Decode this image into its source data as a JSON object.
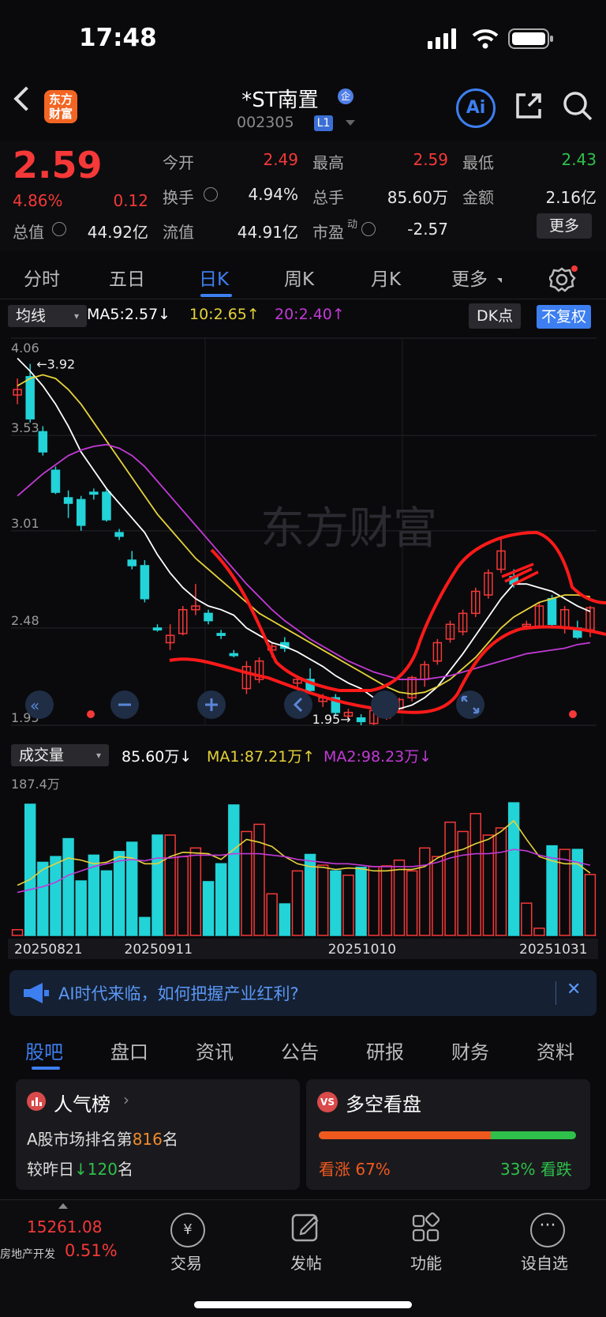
{
  "status": {
    "time": "17:48"
  },
  "header": {
    "logo_line1": "东方",
    "logo_line2": "财富",
    "stock_name": "*ST南置",
    "stock_code": "002305",
    "level": "L1",
    "ai_label": "Ai"
  },
  "quote": {
    "price": "2.59",
    "change_pct": "4.86%",
    "change": "0.12",
    "open_label": "今开",
    "open": "2.49",
    "high_label": "最高",
    "high": "2.59",
    "low_label": "最低",
    "low": "2.43",
    "turnover_label": "换手",
    "turnover": "4.94%",
    "volume_label": "总手",
    "volume": "85.60万",
    "amount_label": "金额",
    "amount": "2.16亿",
    "mktcap_label": "总值",
    "mktcap": "44.92亿",
    "float_label": "流值",
    "float": "44.91亿",
    "pe_label": "市盈",
    "pe_sup": "动",
    "pe": "-2.57",
    "more": "更多"
  },
  "ktabs": [
    "分时",
    "五日",
    "日K",
    "周K",
    "月K",
    "更多"
  ],
  "ma_bar": {
    "selector": "均线",
    "ma5": "MA5:2.57↓",
    "ma10": "10:2.65↑",
    "ma20": "20:2.40↑",
    "dk": "DK点",
    "adjust": "不复权"
  },
  "vol_bar": {
    "selector": "成交量",
    "vol": "85.60万↓",
    "ma1": "MA1:87.21万↑",
    "ma2": "MA2:98.23万↓"
  },
  "colors": {
    "up": "#f53838",
    "down": "#22d3d8",
    "ma5": "#ffffff",
    "ma10": "#e6d23a",
    "ma20": "#c23ad6",
    "accent": "#3d7ff0"
  },
  "chart_data": {
    "type": "candlestick",
    "y_ticks": [
      "4.06",
      "3.53",
      "3.01",
      "2.48",
      "1.95"
    ],
    "ylim": [
      1.95,
      4.06
    ],
    "high_annotation": "3.92",
    "low_annotation": "1.95",
    "ohlc": [
      [
        3.75,
        3.84,
        3.7,
        3.78
      ],
      [
        3.85,
        3.92,
        3.6,
        3.62
      ],
      [
        3.55,
        3.58,
        3.42,
        3.44
      ],
      [
        3.34,
        3.36,
        3.21,
        3.22
      ],
      [
        3.19,
        3.23,
        3.08,
        3.16
      ],
      [
        3.18,
        3.2,
        3.01,
        3.04
      ],
      [
        3.22,
        3.24,
        3.18,
        3.21
      ],
      [
        3.22,
        3.24,
        3.06,
        3.07
      ],
      [
        3.0,
        3.02,
        2.96,
        2.98
      ],
      [
        2.85,
        2.9,
        2.8,
        2.82
      ],
      [
        2.82,
        2.85,
        2.62,
        2.64
      ],
      [
        2.48,
        2.5,
        2.46,
        2.47
      ],
      [
        2.4,
        2.5,
        2.36,
        2.44
      ],
      [
        2.45,
        2.6,
        2.44,
        2.58
      ],
      [
        2.58,
        2.72,
        2.55,
        2.6
      ],
      [
        2.56,
        2.58,
        2.5,
        2.52
      ],
      [
        2.45,
        2.47,
        2.42,
        2.44
      ],
      [
        2.34,
        2.36,
        2.32,
        2.33
      ],
      [
        2.15,
        2.3,
        2.12,
        2.27
      ],
      [
        2.2,
        2.32,
        2.18,
        2.3
      ],
      [
        2.36,
        2.4,
        2.32,
        2.38
      ],
      [
        2.4,
        2.43,
        2.35,
        2.37
      ],
      [
        2.18,
        2.22,
        2.15,
        2.2
      ],
      [
        2.2,
        2.26,
        2.12,
        2.14
      ],
      [
        2.08,
        2.12,
        2.05,
        2.1
      ],
      [
        2.1,
        2.12,
        2.0,
        2.02
      ],
      [
        2.0,
        2.04,
        1.98,
        2.02
      ],
      [
        1.99,
        2.01,
        1.95,
        1.97
      ],
      [
        1.96,
        2.05,
        1.95,
        2.03
      ],
      [
        1.99,
        2.05,
        1.98,
        2.04
      ],
      [
        2.04,
        2.1,
        2.02,
        2.09
      ],
      [
        2.1,
        2.22,
        2.08,
        2.21
      ],
      [
        2.2,
        2.3,
        2.16,
        2.28
      ],
      [
        2.3,
        2.42,
        2.28,
        2.4
      ],
      [
        2.42,
        2.52,
        2.4,
        2.5
      ],
      [
        2.46,
        2.58,
        2.44,
        2.56
      ],
      [
        2.56,
        2.7,
        2.54,
        2.68
      ],
      [
        2.66,
        2.8,
        2.64,
        2.78
      ],
      [
        2.8,
        2.98,
        2.78,
        2.9
      ],
      [
        2.76,
        2.8,
        2.7,
        2.72
      ],
      [
        2.49,
        2.52,
        2.47,
        2.5
      ],
      [
        2.49,
        2.62,
        2.48,
        2.6
      ],
      [
        2.64,
        2.66,
        2.48,
        2.5
      ],
      [
        2.48,
        2.6,
        2.45,
        2.58
      ],
      [
        2.48,
        2.52,
        2.42,
        2.43
      ],
      [
        2.47,
        2.6,
        2.43,
        2.59
      ]
    ],
    "ma5": [
      3.95,
      3.88,
      3.8,
      3.7,
      3.58,
      3.44,
      3.34,
      3.24,
      3.16,
      3.08,
      3.0,
      2.88,
      2.78,
      2.7,
      2.64,
      2.6,
      2.58,
      2.55,
      2.48,
      2.44,
      2.4,
      2.38,
      2.35,
      2.31,
      2.27,
      2.22,
      2.18,
      2.15,
      2.1,
      2.06,
      2.04,
      2.06,
      2.1,
      2.16,
      2.25,
      2.34,
      2.44,
      2.54,
      2.64,
      2.72,
      2.72,
      2.7,
      2.68,
      2.64,
      2.6,
      2.57
    ],
    "ma10": [
      3.8,
      3.84,
      3.86,
      3.84,
      3.78,
      3.7,
      3.6,
      3.5,
      3.4,
      3.3,
      3.2,
      3.1,
      3.02,
      2.94,
      2.86,
      2.8,
      2.74,
      2.68,
      2.62,
      2.56,
      2.52,
      2.48,
      2.44,
      2.4,
      2.36,
      2.32,
      2.28,
      2.24,
      2.2,
      2.16,
      2.13,
      2.12,
      2.13,
      2.16,
      2.2,
      2.26,
      2.32,
      2.4,
      2.48,
      2.54,
      2.58,
      2.62,
      2.64,
      2.66,
      2.66,
      2.65
    ],
    "ma20": [
      3.2,
      3.26,
      3.32,
      3.37,
      3.42,
      3.45,
      3.47,
      3.48,
      3.46,
      3.42,
      3.36,
      3.28,
      3.2,
      3.12,
      3.04,
      2.96,
      2.88,
      2.8,
      2.72,
      2.65,
      2.58,
      2.52,
      2.47,
      2.42,
      2.38,
      2.34,
      2.3,
      2.27,
      2.24,
      2.22,
      2.2,
      2.2,
      2.2,
      2.21,
      2.22,
      2.24,
      2.26,
      2.28,
      2.3,
      2.32,
      2.34,
      2.35,
      2.36,
      2.37,
      2.39,
      2.4
    ],
    "volume_max_label": "187.4万",
    "volume": [
      8,
      183,
      102,
      110,
      135,
      76,
      112,
      90,
      117,
      130,
      25,
      140,
      140,
      110,
      122,
      75,
      100,
      182,
      145,
      155,
      58,
      44,
      90,
      113,
      98,
      90,
      84,
      95,
      96,
      97,
      105,
      90,
      122,
      110,
      158,
      145,
      170,
      140,
      150,
      185,
      45,
      10,
      125,
      120,
      120,
      85
    ],
    "vol_ma1": [
      70,
      78,
      92,
      100,
      108,
      105,
      100,
      102,
      110,
      108,
      100,
      100,
      110,
      116,
      115,
      114,
      106,
      120,
      134,
      130,
      124,
      110,
      100,
      96,
      95,
      92,
      94,
      93,
      90,
      90,
      92,
      92,
      96,
      108,
      116,
      120,
      128,
      134,
      145,
      160,
      134,
      110,
      104,
      100,
      100,
      87
    ],
    "vol_ma2": [
      60,
      64,
      68,
      74,
      84,
      90,
      96,
      100,
      104,
      106,
      104,
      108,
      108,
      110,
      112,
      112,
      112,
      114,
      114,
      114,
      112,
      110,
      106,
      104,
      102,
      100,
      100,
      98,
      96,
      96,
      96,
      96,
      98,
      102,
      108,
      112,
      114,
      114,
      116,
      120,
      118,
      112,
      108,
      106,
      102,
      98
    ],
    "x_dates": [
      "20250821",
      "20250911",
      "20251010",
      "20251031"
    ]
  },
  "ad": {
    "text": "AI时代来临，如何把握产业红利?",
    "close": "✕"
  },
  "btabs": [
    "股吧",
    "盘口",
    "资讯",
    "公告",
    "研报",
    "财务",
    "资料"
  ],
  "popularity": {
    "title": "人气榜",
    "rank_prefix": "A股市场排名第",
    "rank": "816",
    "rank_suffix": "名",
    "cmp_prefix": "较昨日",
    "cmp_val": "120",
    "cmp_suffix": "名"
  },
  "sentiment": {
    "title": "多空看盘",
    "badge": "VS",
    "bull_label": "看涨",
    "bull_pct": "67%",
    "bear_pct": "33%",
    "bear_label": "看跌",
    "bull_fraction": 0.67
  },
  "footer": {
    "index_value": "15261.08",
    "index_name": "房地产开发",
    "index_change": "0.51%",
    "items": [
      "交易",
      "发帖",
      "功能",
      "设自选"
    ],
    "trade_symbol": "¥"
  }
}
